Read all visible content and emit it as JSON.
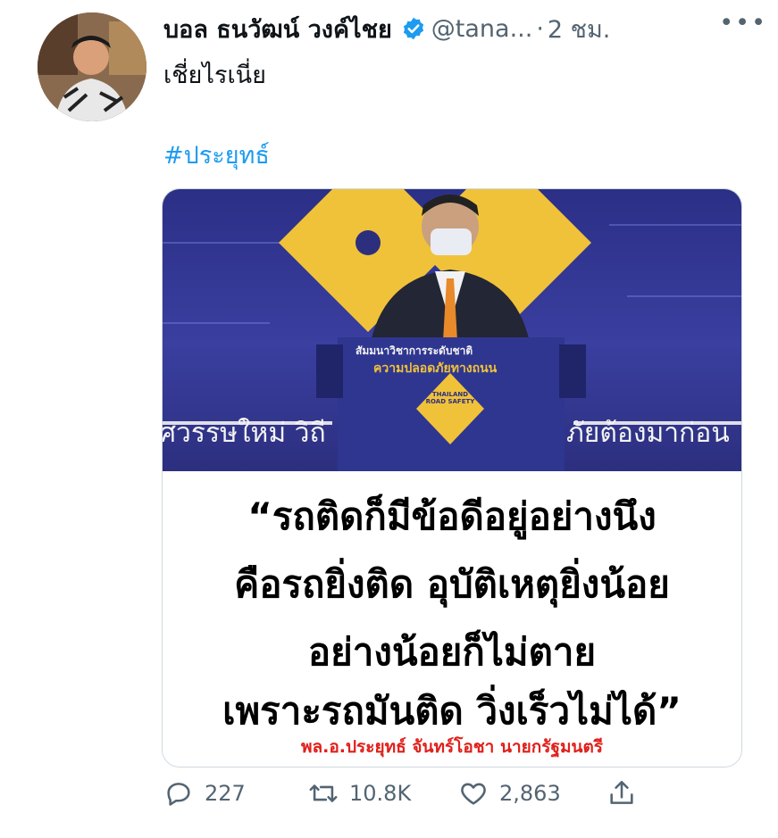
{
  "tweet": {
    "author_name": "บอล ธนวัฒน์ วงค์ไชย",
    "handle": "@tana...",
    "separator": "·",
    "time": "2 ชม.",
    "more": "•••",
    "text": "เชี่ยไรเนี่ย",
    "hashtag": "#ประยุทธ์"
  },
  "media": {
    "photo_banner_text": "ศวรรษใหม่ วิถี",
    "photo_banner_text_right": "ภัยต้องมาก่อน",
    "podium_title": "สัมมนาวิชาการระดับชาติ",
    "podium_subtitle": "ความปลอดภัยทางถนน",
    "podium_sign": "THAILAND ROAD SAFETY",
    "quote_lines": [
      "“รถติดก็มีข้อดีอยู่อย่างนึง",
      "คือรถยิ่งติด อุบัติเหตุยิ่งน้อย",
      "อย่างน้อยก็ไม่ตาย",
      "เพราะรถมันติด วิ่งเร็วไม่ได้”"
    ],
    "caption": "พล.อ.ประยุทธ์ จันทร์โอชา นายกรัฐมนตรี"
  },
  "actions": {
    "reply_count": "227",
    "retweet_count": "10.8K",
    "like_count": "2,863"
  },
  "colors": {
    "link": "#1d9bf0",
    "muted": "#536471",
    "caption_red": "#e0201b"
  }
}
